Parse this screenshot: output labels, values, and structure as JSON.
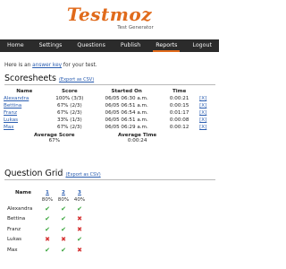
{
  "app": {
    "title": "Testmoz",
    "subtitle": "Test Generator"
  },
  "nav": [
    {
      "label": "Home",
      "active": false
    },
    {
      "label": "Settings",
      "active": false
    },
    {
      "label": "Questions",
      "active": false
    },
    {
      "label": "Publish",
      "active": false
    },
    {
      "label": "Reports",
      "active": true
    },
    {
      "label": "Logout",
      "active": false
    }
  ],
  "intro": {
    "before": "Here is an ",
    "link": "answer key",
    "after": " for your test."
  },
  "scoresheets": {
    "title": "Scoresheets",
    "csv_link": "(Export as CSV)",
    "headers": {
      "name": "Name",
      "score": "Score",
      "started": "Started On",
      "time": "Time"
    },
    "rows": [
      {
        "name": "Alexandra",
        "score": "100% (3/3)",
        "started": "06/05 06:30 a.m.",
        "time": "0:00:21",
        "x": "[X]"
      },
      {
        "name": "Bettina",
        "score": "67% (2/3)",
        "started": "06/05 06:51 a.m.",
        "time": "0:00:15",
        "x": "[X]"
      },
      {
        "name": "Franz",
        "score": "67% (2/3)",
        "started": "06/05 06:54 a.m.",
        "time": "0:01:17",
        "x": "[X]"
      },
      {
        "name": "Lukas",
        "score": "33% (1/3)",
        "started": "06/05 06:51 a.m.",
        "time": "0:00:08",
        "x": "[X]"
      },
      {
        "name": "Max",
        "score": "67% (2/3)",
        "started": "06/05 06:29 a.m.",
        "time": "0:00:12",
        "x": "[X]"
      }
    ],
    "average_score_label": "Average Score",
    "average_score": "67%",
    "average_time_label": "Average Time",
    "average_time": "0:00:24"
  },
  "question_grid": {
    "title": "Question Grid",
    "csv_link": "(Export as CSV)",
    "name_header": "Name",
    "questions": [
      "1",
      "2",
      "3"
    ],
    "percentages": [
      "80%",
      "80%",
      "40%"
    ],
    "check_color": "#37a33a",
    "cross_color": "#d53232",
    "rows": [
      {
        "name": "Alexandra",
        "marks": [
          "check",
          "check",
          "check"
        ]
      },
      {
        "name": "Bettina",
        "marks": [
          "check",
          "check",
          "cross"
        ]
      },
      {
        "name": "Franz",
        "marks": [
          "check",
          "check",
          "cross"
        ]
      },
      {
        "name": "Lukas",
        "marks": [
          "cross",
          "cross",
          "check"
        ]
      },
      {
        "name": "Max",
        "marks": [
          "check",
          "check",
          "cross"
        ]
      }
    ]
  },
  "accent_color": "#e06a1b",
  "link_color": "#2a5db0"
}
